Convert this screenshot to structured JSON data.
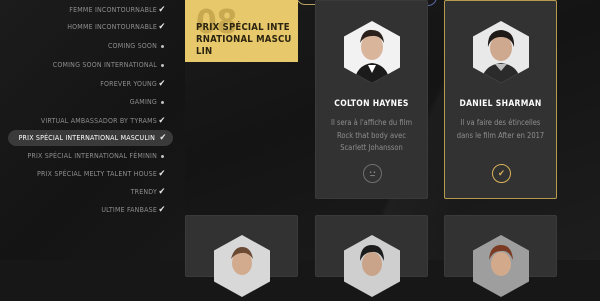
{
  "categories": [
    {
      "label": "FEMME INCONTOURNABLE",
      "state": "check"
    },
    {
      "label": "HOMME INCONTOURNABLE",
      "state": "check"
    },
    {
      "label": "COMING SOON",
      "state": "dot"
    },
    {
      "label": "COMING SOON INTERNATIONAL",
      "state": "dot"
    },
    {
      "label": "FOREVER YOUNG",
      "state": "check"
    },
    {
      "label": "GAMING",
      "state": "dot"
    },
    {
      "label": "VIRTUAL AMBASSADOR BY TYRAMS",
      "state": "check"
    },
    {
      "label": "PRIX SPÉCIAL INTERNATIONAL MASCULIN",
      "state": "check",
      "active": true
    },
    {
      "label": "PRIX SPÉCIAL INTERNATIONAL FÉMININ",
      "state": "dot"
    },
    {
      "label": "PRIX SPÉCIAL MELTY TALENT HOUSE",
      "state": "check"
    },
    {
      "label": "TRENDY",
      "state": "check"
    },
    {
      "label": "ULTIME FANBASE",
      "state": "check"
    }
  ],
  "active_category": {
    "number": "08",
    "title": "PRIX SPÉCIAL INTERNATIONAL MASCULIN"
  },
  "nominees": [
    {
      "name": "COLTON HAYNES",
      "description": "Il sera à l'affiche du film Rock that body avec Scarlett Johansson",
      "voted": false,
      "vote_icon": "undecided-face-icon"
    },
    {
      "name": "DANIEL SHARMAN",
      "description": "Il va faire des étincelles dans le film After en 2017",
      "voted": true,
      "vote_icon": "checkmark-icon"
    }
  ],
  "colors": {
    "accent_gold": "#e7c86a",
    "selected_border": "#b79a4d",
    "check_gold": "#d9b35a",
    "green_button": "#2ea84c"
  }
}
